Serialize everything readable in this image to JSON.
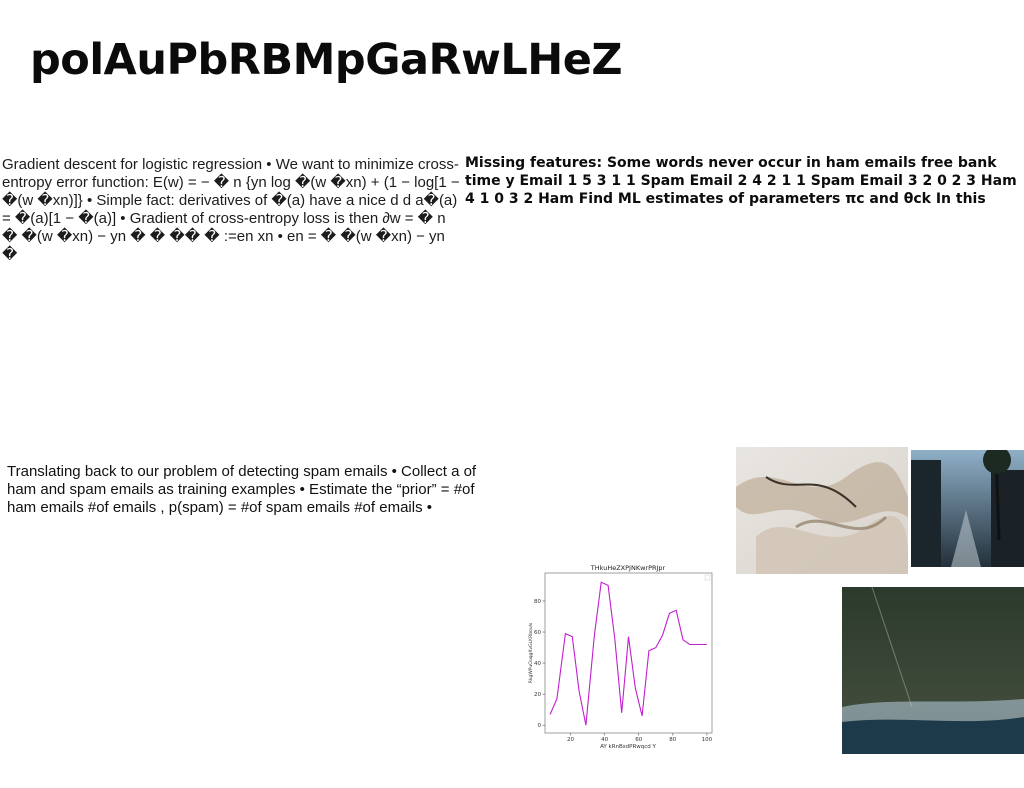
{
  "title": "polAuPbRBMpGaRwLHeZ",
  "block1": "Gradient descent for logistic regression • We want to minimize cross-entropy error function: E(w) = − � n {yn log �(w �xn) + (1 − log[1 − �(w �xn)]} • Simple fact: derivatives of �(a) have a nice d d a�(a) = �(a)[1 − �(a)] • Gradient of cross-entropy loss is then ∂w = � n � �(w �xn) − yn � � �� � :=en xn • en = � �(w �xn) − yn �",
  "block2": "Missing features: Some words never occur in ham emails free bank time y Email 1 5 3 1 1 Spam Email 2 4 2 1 1 Spam Email 3 2 0 2 3 Ham 4 1 0 3 2 Ham Find ML estimates of parameters πc and θck In this",
  "block3": "Translating back to our problem of detecting spam emails • Collect a of ham and spam emails as training examples • Estimate the “prior” = #of ham emails #of emails , p(spam) = #of spam emails #of emails •",
  "chart_data": {
    "type": "line",
    "title": "THkuHeZXPJNKwrPRJpr",
    "xlabel": "AY kRnBsdPRwqcd Y",
    "ylabel": "RkgWPuOuqgXvGLKRbouls",
    "xlim": [
      5,
      103
    ],
    "ylim": [
      -5,
      98
    ],
    "xticks": [
      20,
      40,
      60,
      80,
      100
    ],
    "yticks": [
      0,
      20,
      40,
      60,
      80
    ],
    "color": "#c21fd0",
    "series": [
      {
        "x": [
          8,
          12,
          17,
          21,
          25,
          29,
          34,
          38,
          42,
          46,
          50,
          54,
          58,
          62,
          66,
          70,
          74,
          78,
          82,
          86,
          90,
          94,
          98,
          100
        ],
        "values": [
          7,
          17,
          59,
          57,
          22,
          0,
          58,
          92,
          90,
          55,
          8,
          57,
          24,
          6,
          48,
          50,
          58,
          72,
          74,
          55,
          52,
          52,
          52,
          52
        ]
      }
    ]
  }
}
